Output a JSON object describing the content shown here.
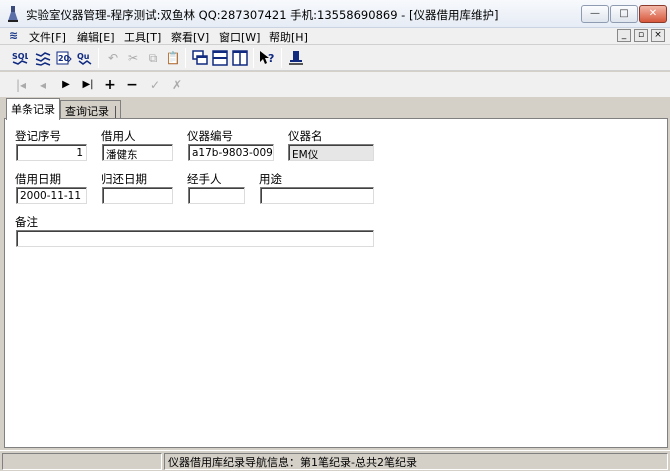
{
  "window": {
    "title": "实验室仪器管理-程序测试:双鱼林  QQ:287307421 手机:13558690869 - [仪器借用库维护]",
    "buttons": [
      "—",
      "□",
      "✕"
    ]
  },
  "menubar": {
    "items": [
      "文件[F]",
      "编辑[E]",
      "工具[T]",
      "察看[V]",
      "窗口[W]",
      "帮助[H]"
    ],
    "mdi_buttons": [
      "_",
      "▫",
      "×"
    ]
  },
  "toolbar": {
    "icons": [
      "report-icon-1",
      "report-icon-2",
      "report-icon-3",
      "report-icon-4",
      "undo-icon",
      "cut-icon",
      "copy-icon",
      "paste-icon",
      "cascade-icon",
      "tile-horizontal-icon",
      "tile-vertical-icon",
      "help-icon",
      "exit-icon"
    ]
  },
  "navbar": {
    "icons": [
      "first-record-icon",
      "prev-record-icon",
      "next-record-icon",
      "last-record-icon",
      "add-record-icon",
      "delete-record-icon",
      "edit-record-icon",
      "cancel-record-icon"
    ]
  },
  "tabs": [
    "单条记录",
    "查询记录"
  ],
  "form": {
    "reg_no": {
      "label": "登记序号",
      "value": "1"
    },
    "borrower": {
      "label": "借用人",
      "value": "潘健东"
    },
    "instrument_no": {
      "label": "仪器编号",
      "value": "a17b-9803-009"
    },
    "instrument_name": {
      "label": "仪器名",
      "value": "EM仪"
    },
    "borrow_date": {
      "label": "借用日期",
      "value": "2000-11-11"
    },
    "return_date": {
      "label": "归还日期",
      "value": ""
    },
    "handler": {
      "label": "经手人",
      "value": ""
    },
    "purpose": {
      "label": "用途",
      "value": ""
    },
    "remark": {
      "label": "备注",
      "value": ""
    }
  },
  "status": {
    "text": "仪器借用库纪录导航信息：第1笔纪录-总共2笔纪录"
  }
}
